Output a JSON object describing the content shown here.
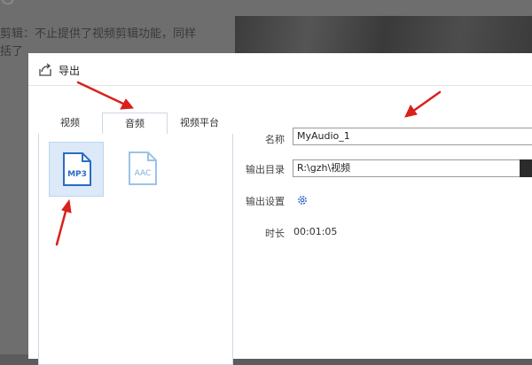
{
  "background": {
    "heading_fragment": "O",
    "line1": "剪辑：不止提供了视频剪辑功能，同样",
    "line2": "括了"
  },
  "dialog": {
    "title": "导出",
    "tabs": [
      {
        "label": "视频",
        "active": false
      },
      {
        "label": "音频",
        "active": true
      },
      {
        "label": "视频平台",
        "active": false
      }
    ],
    "formats": [
      {
        "label": "MP3",
        "selected": true,
        "icon": "mp3-file-icon"
      },
      {
        "label": "AAC",
        "selected": false,
        "icon": "aac-file-icon"
      }
    ],
    "form": {
      "name_label": "名称",
      "name_value": "MyAudio_1",
      "output_dir_label": "输出目录",
      "output_dir_value": "R:\\gzh\\视频",
      "output_settings_label": "输出设置",
      "duration_label": "时长",
      "duration_value": "00:01:05"
    }
  },
  "colors": {
    "accent": "#2b6cc4",
    "selected_tile": "#dbe9f9",
    "annotation": "#d9201c"
  }
}
